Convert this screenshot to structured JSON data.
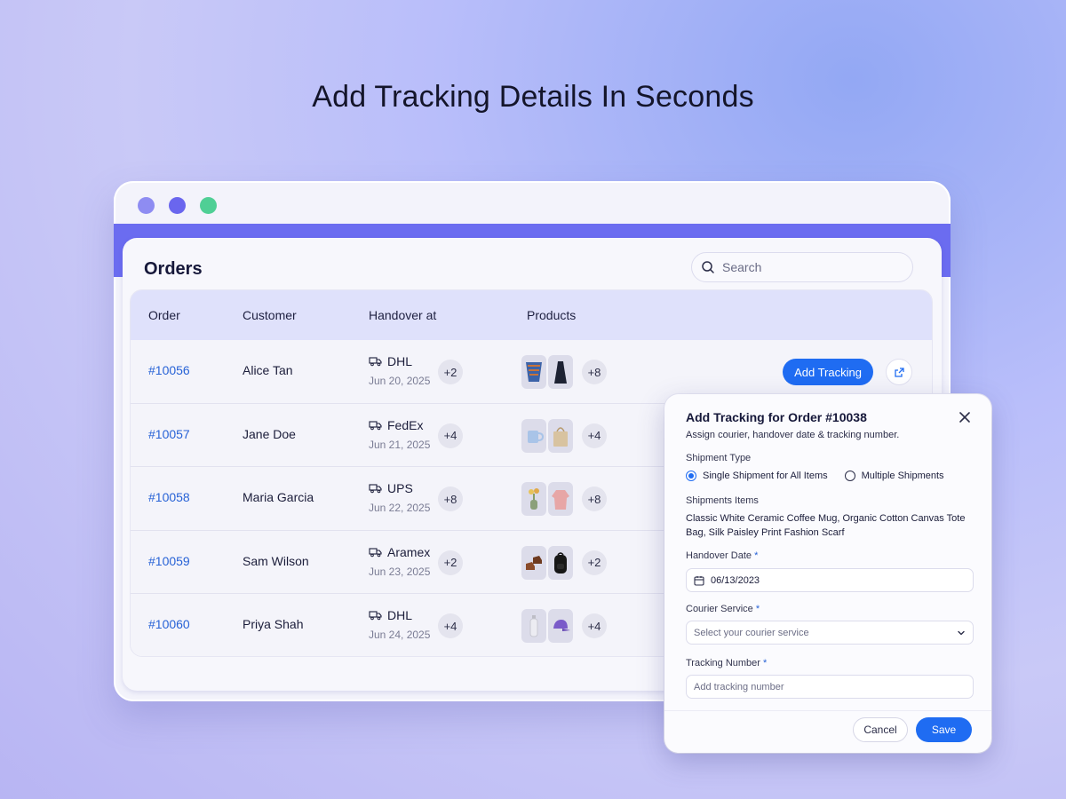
{
  "headline": "Add Tracking Details In Seconds",
  "window_dots": [
    "#8e8cf2",
    "#6a66ee",
    "#4fcf95"
  ],
  "orders": {
    "title": "Orders",
    "search_placeholder": "Search",
    "columns": [
      "Order",
      "Customer",
      "Handover at",
      "Products"
    ],
    "add_tracking_label": "Add Tracking",
    "rows": [
      {
        "id": "#10056",
        "customer": "Alice Tan",
        "courier": "DHL",
        "date": "Jun 20, 2025",
        "handover_extra": "+2",
        "product_icons": [
          "scarf",
          "dress"
        ],
        "products_extra": "+8"
      },
      {
        "id": "#10057",
        "customer": "Jane Doe",
        "courier": "FedEx",
        "date": "Jun 21, 2025",
        "handover_extra": "+4",
        "product_icons": [
          "mug",
          "tote-bag"
        ],
        "products_extra": "+4"
      },
      {
        "id": "#10058",
        "customer": "Maria Garcia",
        "courier": "UPS",
        "date": "Jun 22, 2025",
        "handover_extra": "+8",
        "product_icons": [
          "vase",
          "sweater"
        ],
        "products_extra": "+8"
      },
      {
        "id": "#10059",
        "customer": "Sam Wilson",
        "courier": "Aramex",
        "date": "Jun 23, 2025",
        "handover_extra": "+2",
        "product_icons": [
          "shoes",
          "backpack"
        ],
        "products_extra": "+2"
      },
      {
        "id": "#10060",
        "customer": "Priya Shah",
        "courier": "DHL",
        "date": "Jun 24, 2025",
        "handover_extra": "+4",
        "product_icons": [
          "bottle",
          "cap"
        ],
        "products_extra": "+4"
      }
    ]
  },
  "modal": {
    "title": "Add Tracking for Order #10038",
    "subtitle": "Assign courier, handover date & tracking number.",
    "shipment_type_label": "Shipment Type",
    "option_single": "Single Shipment for All Items",
    "option_multiple": "Multiple Shipments",
    "selected_option": "single",
    "items_label": "Shipments Items",
    "items_text": "Classic White Ceramic Coffee Mug, Organic Cotton Canvas Tote Bag, Silk Paisley Print Fashion Scarf",
    "handover_label": "Handover Date",
    "handover_value": "06/13/2023",
    "courier_label": "Courier Service",
    "courier_placeholder": "Select your courier service",
    "tracking_label": "Tracking Number",
    "tracking_placeholder": "Add tracking number",
    "required_mark": "*",
    "cancel_label": "Cancel",
    "save_label": "Save"
  },
  "colors": {
    "accent": "#1f6cf2",
    "band": "#6b6cf0",
    "link": "#2762d6"
  }
}
